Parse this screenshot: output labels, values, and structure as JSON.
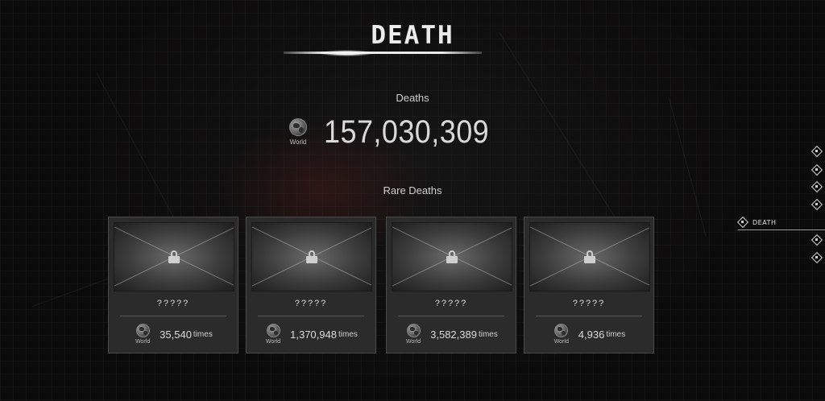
{
  "page": {
    "title": "DEATH"
  },
  "totals": {
    "label": "Deaths",
    "scope_label": "World",
    "value": "157,030,309"
  },
  "rare": {
    "label": "Rare Deaths",
    "cards": [
      {
        "name": "?????",
        "scope_label": "World",
        "count": "35,540",
        "unit": "times"
      },
      {
        "name": "?????",
        "scope_label": "World",
        "count": "1,370,948",
        "unit": "times"
      },
      {
        "name": "?????",
        "scope_label": "World",
        "count": "3,582,389",
        "unit": "times"
      },
      {
        "name": "?????",
        "scope_label": "World",
        "count": "4,936",
        "unit": "times"
      }
    ]
  },
  "side_nav": {
    "active_label": "DEATH",
    "icon": "map-pin-diamond-icon",
    "items_count_above": 4,
    "items_count_below": 2
  },
  "colors": {
    "background": "#0c0b0b",
    "card": "#2b2b2b",
    "text": "#d6d6d6"
  }
}
